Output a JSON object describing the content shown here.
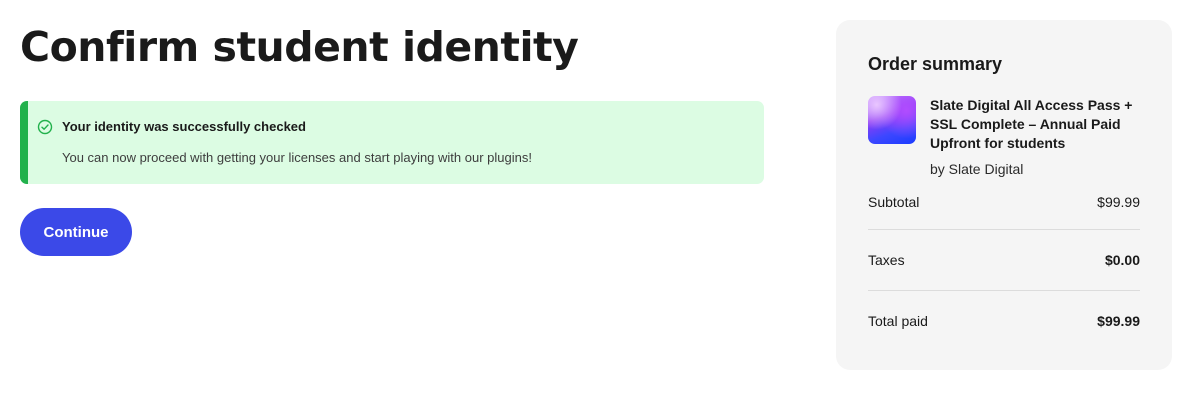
{
  "main": {
    "title": "Confirm student identity",
    "alert": {
      "title": "Your identity was successfully checked",
      "message": "You can now proceed with getting your licenses and start playing with our plugins!",
      "icon": "check-circle-icon",
      "accent_color": "#22b14c",
      "background_color": "#dcfce3"
    },
    "continue_label": "Continue",
    "button_color": "#3b49e8"
  },
  "summary": {
    "title": "Order summary",
    "product": {
      "name": "Slate Digital All Access Pass + SSL Complete – Annual Paid Upfront for students",
      "vendor": "by Slate Digital"
    },
    "rows": [
      {
        "label": "Subtotal",
        "value": "$99.99"
      },
      {
        "label": "Taxes",
        "value": "$0.00"
      },
      {
        "label": "Total paid",
        "value": "$99.99"
      }
    ]
  }
}
